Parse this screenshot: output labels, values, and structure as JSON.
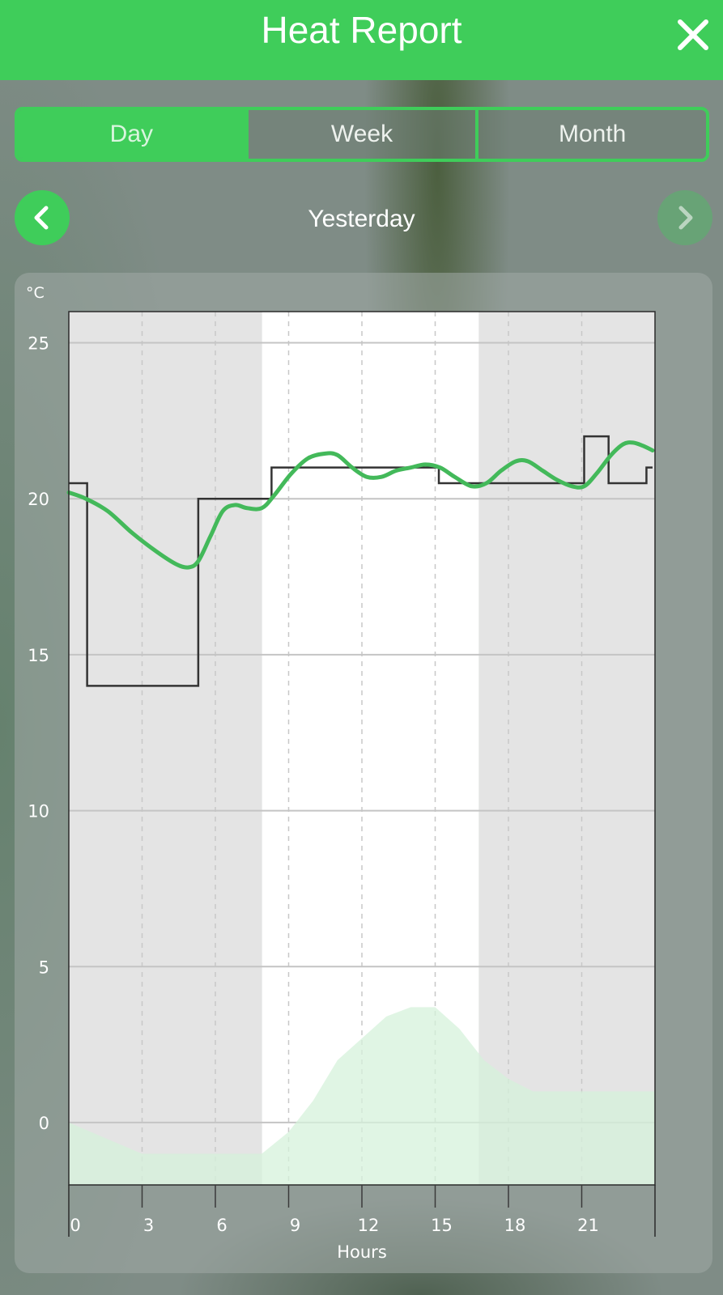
{
  "header": {
    "title": "Heat Report",
    "close_icon": "close-icon"
  },
  "tabs": [
    {
      "label": "Day",
      "active": true
    },
    {
      "label": "Week",
      "active": false
    },
    {
      "label": "Month",
      "active": false
    }
  ],
  "navigation": {
    "period_label": "Yesterday",
    "prev_icon": "chevron-left-icon",
    "next_icon": "chevron-right-icon",
    "next_enabled": false
  },
  "colors": {
    "accent": "#3fcd5a",
    "measured_line": "#43b95a",
    "setpoint_line": "#333333",
    "outdoor_fill": "#d6f1db",
    "night_band": "#e4e4e4",
    "day_band": "#ffffff"
  },
  "chart_data": {
    "type": "line",
    "unit_label": "°C",
    "xlabel": "Hours",
    "xlim": [
      0,
      24
    ],
    "ylim": [
      -2,
      26
    ],
    "x_ticks": [
      0,
      3,
      6,
      9,
      12,
      15,
      18,
      21
    ],
    "y_ticks": [
      0,
      5,
      10,
      15,
      20,
      25
    ],
    "grid": true,
    "daylight_band": [
      7.9,
      16.8
    ],
    "series": [
      {
        "role": "measured",
        "style": "line",
        "x": [
          0,
          0.7,
          1.6,
          2.6,
          3.6,
          4.4,
          4.9,
          5.3,
          5.8,
          6.3,
          6.8,
          7.3,
          7.9,
          8.4,
          9.1,
          9.8,
          10.5,
          11.0,
          11.6,
          12.2,
          12.8,
          13.4,
          14.0,
          14.6,
          15.2,
          15.8,
          16.5,
          17.1,
          17.7,
          18.3,
          18.8,
          19.4,
          20.0,
          20.6,
          21.1,
          21.6,
          22.2,
          22.7,
          23.1,
          23.5,
          23.9
        ],
        "y": [
          20.2,
          20.0,
          19.6,
          18.9,
          18.3,
          17.9,
          17.8,
          18.0,
          18.8,
          19.6,
          19.8,
          19.7,
          19.7,
          20.1,
          20.8,
          21.3,
          21.45,
          21.4,
          21.0,
          20.7,
          20.7,
          20.9,
          21.0,
          21.1,
          21.0,
          20.7,
          20.4,
          20.5,
          20.9,
          21.2,
          21.2,
          20.9,
          20.6,
          20.4,
          20.4,
          20.8,
          21.4,
          21.75,
          21.8,
          21.7,
          21.55
        ]
      },
      {
        "role": "setpoint",
        "style": "step",
        "x": [
          0,
          0.75,
          5.3,
          8.3,
          15.15,
          21.1,
          22.1,
          23.65,
          23.9
        ],
        "y": [
          20.5,
          14.0,
          20.0,
          21.0,
          20.5,
          22.0,
          20.5,
          21.0,
          21.0
        ]
      },
      {
        "role": "outdoor",
        "style": "area",
        "x": [
          0,
          1.5,
          3.0,
          4.5,
          6.0,
          7.9,
          9.0,
          10.0,
          11.0,
          12.0,
          13.0,
          14.0,
          15.0,
          16.0,
          17.0,
          18.0,
          19.0,
          20.0,
          21.0,
          22.0,
          23.0,
          24.0
        ],
        "y": [
          0.0,
          -0.5,
          -1.0,
          -1.0,
          -1.0,
          -1.0,
          -0.3,
          0.7,
          2.0,
          2.7,
          3.4,
          3.7,
          3.7,
          3.0,
          2.0,
          1.4,
          1.0,
          1.0,
          1.0,
          1.0,
          1.0,
          1.0
        ]
      }
    ]
  }
}
